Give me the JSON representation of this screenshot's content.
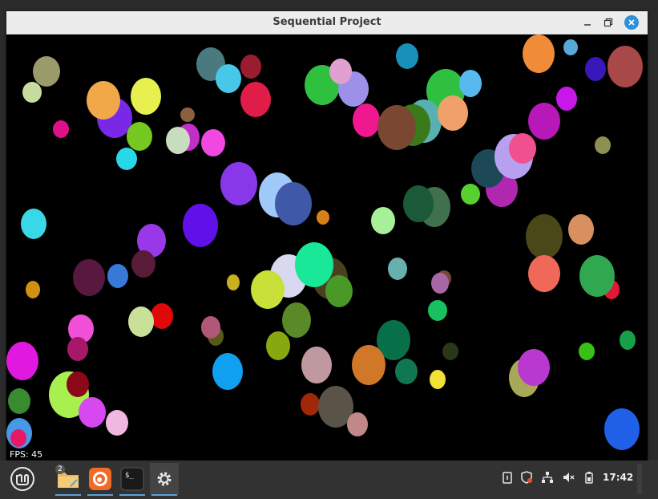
{
  "window": {
    "title": "Sequential Project"
  },
  "canvas": {
    "fps_label": "FPS: 45"
  },
  "taskbar": {
    "menu_icon": "mint-logo-icon",
    "apps": [
      {
        "name": "files",
        "icon": "folder-icon",
        "badge": "2"
      },
      {
        "name": "firefox",
        "icon": "firefox-icon"
      },
      {
        "name": "terminal",
        "icon": "terminal-icon",
        "glyph": "$_"
      },
      {
        "name": "settings",
        "icon": "gear-icon"
      }
    ],
    "tray": [
      "clipboard-icon",
      "shield-icon",
      "network-icon",
      "volume-muted-icon",
      "battery-icon"
    ],
    "clock": "17:42"
  },
  "colors": {
    "titlebar": "#ececec",
    "close": "#2f8fd8",
    "taskbar": "#323232",
    "accent": "#5aa0d8"
  }
}
